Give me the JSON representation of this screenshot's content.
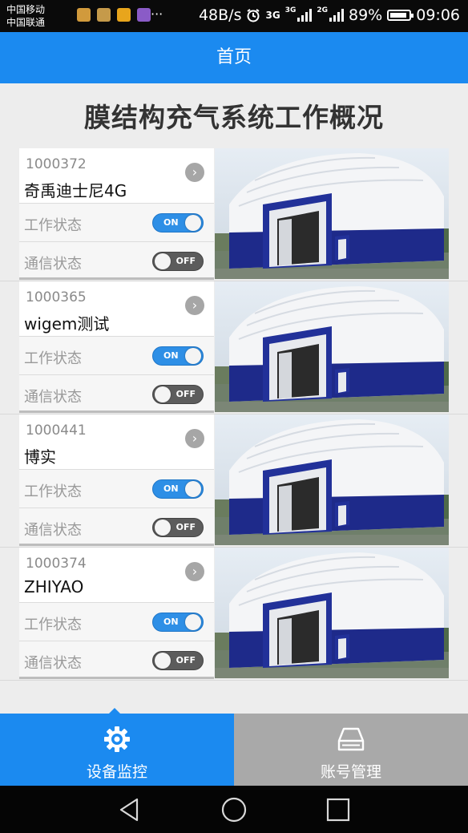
{
  "status_bar": {
    "carrier_1": "中国移动",
    "carrier_2": "中国联通",
    "more": "···",
    "net_speed": "48B/s",
    "net_3g_a": "3G",
    "net_3g_b": "3G",
    "net_2g": "2G",
    "battery": "89%",
    "battery_level": 0.89,
    "time": "09:06",
    "icons": [
      "alarm-icon",
      "signal-icon",
      "battery-icon"
    ]
  },
  "app_bar": {
    "title": "首页"
  },
  "page_title": "膜结构充气系统工作概况",
  "devices": [
    {
      "id": "1000372",
      "name": "奇禹迪士尼4G",
      "work_label": "工作状态",
      "work_toggle": "ON",
      "comm_label": "通信状态",
      "comm_toggle": "OFF"
    },
    {
      "id": "1000365",
      "name": "wigem测试",
      "work_label": "工作状态",
      "work_toggle": "ON",
      "comm_label": "通信状态",
      "comm_toggle": "OFF"
    },
    {
      "id": "1000441",
      "name": "博实",
      "work_label": "工作状态",
      "work_toggle": "ON",
      "comm_label": "通信状态",
      "comm_toggle": "OFF"
    },
    {
      "id": "1000374",
      "name": "ZHIYAO",
      "work_label": "工作状态",
      "work_toggle": "ON",
      "comm_label": "通信状态",
      "comm_toggle": "OFF"
    }
  ],
  "tabs": [
    {
      "label": "设备监控",
      "icon": "gear-icon",
      "active": true
    },
    {
      "label": "账号管理",
      "icon": "drive-icon",
      "active": false
    }
  ],
  "nav": [
    "back-icon",
    "home-icon",
    "recents-icon"
  ],
  "colors": {
    "primary": "#1b8af0",
    "tab_inactive": "#a9a9a9",
    "dome_blue": "#1e2a8a"
  }
}
